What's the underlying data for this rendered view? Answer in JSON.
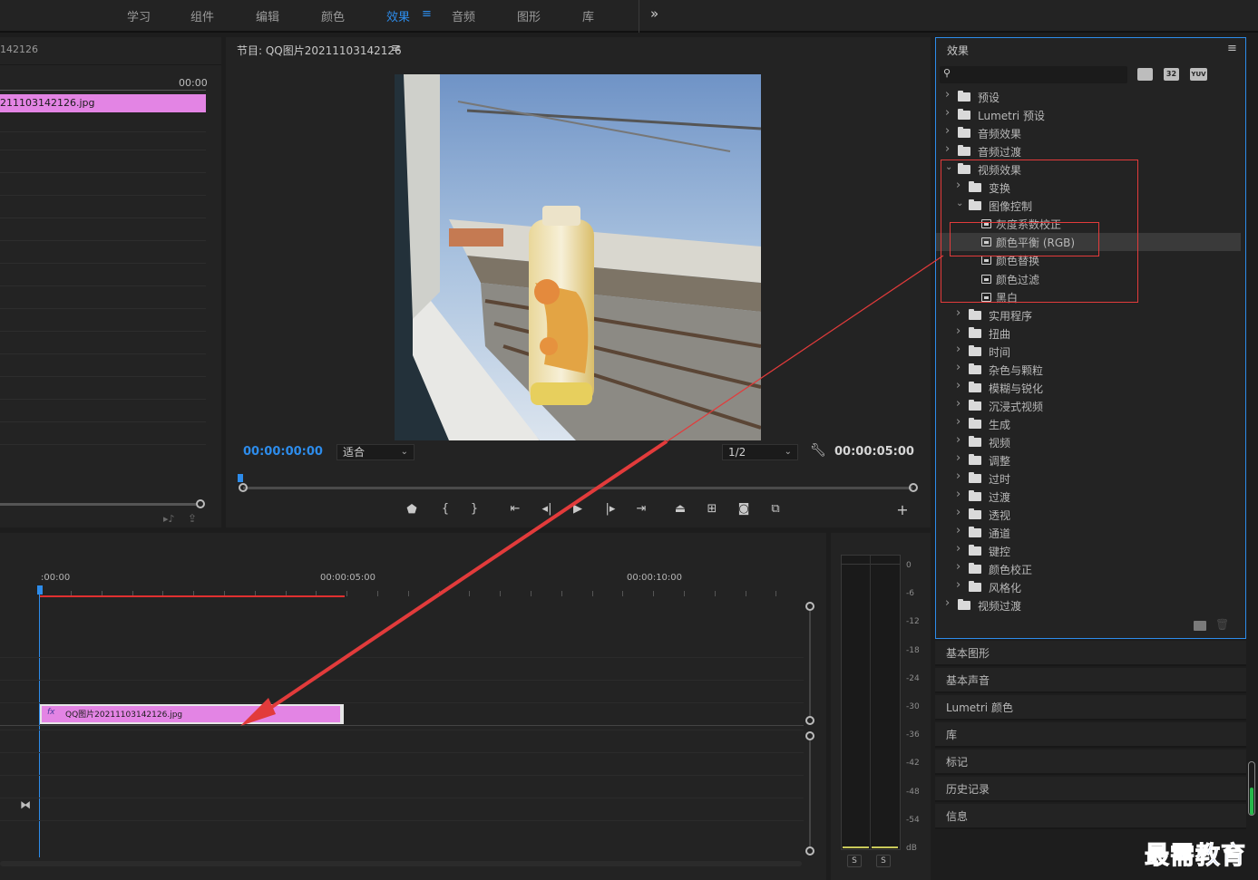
{
  "workspace_tabs": [
    {
      "label": "学习"
    },
    {
      "label": "组件"
    },
    {
      "label": "编辑"
    },
    {
      "label": "颜色"
    },
    {
      "label": "效果",
      "active": true
    },
    {
      "label": "音频"
    },
    {
      "label": "图形"
    },
    {
      "label": "库"
    }
  ],
  "workspace_active_menu": "≡",
  "workspace_overflow": "»",
  "source_panel": {
    "title_fragment": "142126",
    "timecode": "00:00",
    "clip_label": "211103142126.jpg"
  },
  "program_monitor": {
    "title": "节目: QQ图片20211103142126",
    "menu_icon": "≡",
    "current_timecode": "00:00:00:00",
    "fit_value": "适合",
    "resolution_value": "1/2",
    "duration_timecode": "00:00:05:00"
  },
  "effects_panel": {
    "title": "效果",
    "menu_icon": "≡",
    "badge_32": "32",
    "badge_yuv": "YUV",
    "tree": [
      {
        "label": "预设",
        "level": 0,
        "expanded": false,
        "kind": "preset"
      },
      {
        "label": "Lumetri 预设",
        "level": 0,
        "expanded": false,
        "kind": "preset"
      },
      {
        "label": "音频效果",
        "level": 0,
        "expanded": false,
        "kind": "folder"
      },
      {
        "label": "音频过渡",
        "level": 0,
        "expanded": false,
        "kind": "folder"
      },
      {
        "label": "视频效果",
        "level": 0,
        "expanded": true,
        "kind": "folder"
      },
      {
        "label": "变换",
        "level": 1,
        "expanded": false,
        "kind": "folder"
      },
      {
        "label": "图像控制",
        "level": 1,
        "expanded": true,
        "kind": "folder"
      },
      {
        "label": "灰度系数校正",
        "level": 2,
        "kind": "effect"
      },
      {
        "label": "颜色平衡 (RGB)",
        "level": 2,
        "kind": "effect",
        "selected": true
      },
      {
        "label": "颜色替换",
        "level": 2,
        "kind": "effect"
      },
      {
        "label": "颜色过滤",
        "level": 2,
        "kind": "effect"
      },
      {
        "label": "黑白",
        "level": 2,
        "kind": "effect"
      },
      {
        "label": "实用程序",
        "level": 1,
        "expanded": false,
        "kind": "folder"
      },
      {
        "label": "扭曲",
        "level": 1,
        "expanded": false,
        "kind": "folder"
      },
      {
        "label": "时间",
        "level": 1,
        "expanded": false,
        "kind": "folder"
      },
      {
        "label": "杂色与颗粒",
        "level": 1,
        "expanded": false,
        "kind": "folder"
      },
      {
        "label": "模糊与锐化",
        "level": 1,
        "expanded": false,
        "kind": "folder"
      },
      {
        "label": "沉浸式视频",
        "level": 1,
        "expanded": false,
        "kind": "folder"
      },
      {
        "label": "生成",
        "level": 1,
        "expanded": false,
        "kind": "folder"
      },
      {
        "label": "视频",
        "level": 1,
        "expanded": false,
        "kind": "folder"
      },
      {
        "label": "调整",
        "level": 1,
        "expanded": false,
        "kind": "folder"
      },
      {
        "label": "过时",
        "level": 1,
        "expanded": false,
        "kind": "folder"
      },
      {
        "label": "过渡",
        "level": 1,
        "expanded": false,
        "kind": "folder"
      },
      {
        "label": "透视",
        "level": 1,
        "expanded": false,
        "kind": "folder"
      },
      {
        "label": "通道",
        "level": 1,
        "expanded": false,
        "kind": "folder"
      },
      {
        "label": "键控",
        "level": 1,
        "expanded": false,
        "kind": "folder"
      },
      {
        "label": "颜色校正",
        "level": 1,
        "expanded": false,
        "kind": "folder"
      },
      {
        "label": "风格化",
        "level": 1,
        "expanded": false,
        "kind": "folder"
      },
      {
        "label": "视频过渡",
        "level": 0,
        "expanded": false,
        "kind": "folder"
      }
    ]
  },
  "side_panels": [
    {
      "label": "基本图形"
    },
    {
      "label": "基本声音"
    },
    {
      "label": "Lumetri 颜色"
    },
    {
      "label": "库"
    },
    {
      "label": "标记"
    },
    {
      "label": "历史记录"
    },
    {
      "label": "信息"
    }
  ],
  "timeline": {
    "ruler_labels": [
      ":00:00",
      "00:00:05:00",
      "00:00:10:00"
    ],
    "clip_fx_badge": "fx",
    "clip_label": "QQ图片20211103142126.jpg"
  },
  "audio_meter": {
    "scale": [
      "0",
      "-6",
      "-12",
      "-18",
      "-24",
      "-30",
      "-36",
      "-42",
      "-48",
      "-54",
      "dB"
    ],
    "solo_labels": [
      "S",
      "S"
    ]
  },
  "watermark": "最需教育",
  "colors": {
    "accent_blue": "#2d8ceb",
    "clip_pink": "#e384e4",
    "annotation_red": "#e23b3b",
    "playhead_red": "#e03030"
  }
}
